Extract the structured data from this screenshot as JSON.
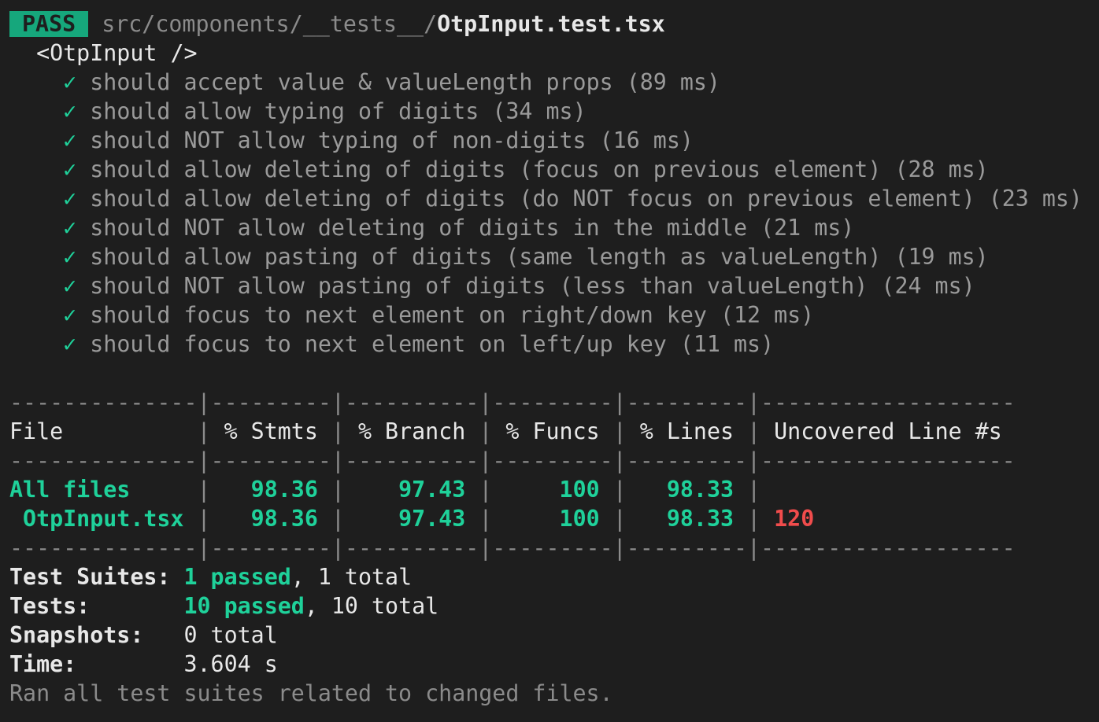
{
  "header": {
    "badge": "PASS",
    "path_dim": "src/components/__tests__/",
    "path_file": "OtpInput.test.tsx"
  },
  "suite": {
    "describe": "<OtpInput />",
    "check_glyph": "✓",
    "tests": [
      {
        "name": "should accept value & valueLength props",
        "time": "(89 ms)"
      },
      {
        "name": "should allow typing of digits",
        "time": "(34 ms)"
      },
      {
        "name": "should NOT allow typing of non-digits",
        "time": "(16 ms)"
      },
      {
        "name": "should allow deleting of digits (focus on previous element)",
        "time": "(28 ms)"
      },
      {
        "name": "should allow deleting of digits (do NOT focus on previous element)",
        "time": "(23 ms)"
      },
      {
        "name": "should NOT allow deleting of digits in the middle",
        "time": "(21 ms)"
      },
      {
        "name": "should allow pasting of digits (same length as valueLength)",
        "time": "(19 ms)"
      },
      {
        "name": "should NOT allow pasting of digits (less than valueLength)",
        "time": "(24 ms)"
      },
      {
        "name": "should focus to next element on right/down key",
        "time": "(12 ms)"
      },
      {
        "name": "should focus to next element on left/up key",
        "time": "(11 ms)"
      }
    ]
  },
  "coverage": {
    "separator": "--------------|---------|----------|---------|---------|-------------------",
    "headers": {
      "file": "File          ",
      "stmts": " % Stmts ",
      "branch": " % Branch ",
      "funcs": " % Funcs ",
      "lines": " % Lines ",
      "uncovered": " Uncovered Line #s "
    },
    "rows": [
      {
        "file": "All files     ",
        "stmts": "   98.36 ",
        "branch": "    97.43 ",
        "funcs": "     100 ",
        "lines": "   98.33 ",
        "uncovered": " "
      },
      {
        "file": " OtpInput.tsx ",
        "stmts": "   98.36 ",
        "branch": "    97.43 ",
        "funcs": "     100 ",
        "lines": "   98.33 ",
        "uncovered": " 120"
      }
    ]
  },
  "summary": {
    "suites_label": "Test Suites: ",
    "suites_passed": "1 passed",
    "suites_rest": ", 1 total",
    "tests_label": "Tests:       ",
    "tests_passed": "10 passed",
    "tests_rest": ", 10 total",
    "snapshots_label": "Snapshots:   ",
    "snapshots_value": "0 total",
    "time_label": "Time:        ",
    "time_value": "3.604 s",
    "footer": "Ran all test suites related to changed files."
  },
  "colors": {
    "background": "#1e1e1e",
    "pass_green": "#16a77c",
    "success_green": "#1fd19a",
    "error_red": "#f04c4c",
    "dim_gray": "#8b8b8b"
  }
}
